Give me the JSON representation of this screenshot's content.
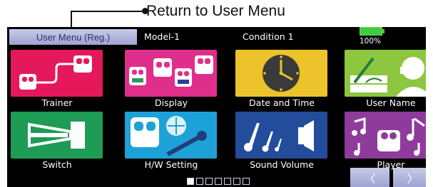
{
  "callout": {
    "text": "Return to User Menu"
  },
  "header": {
    "menu_button": "User Menu (Reg.)",
    "model": "Model-1",
    "condition": "Condition 1",
    "battery_percent": "100%"
  },
  "tiles": [
    {
      "label": "Trainer",
      "color": "#e4185a"
    },
    {
      "label": "Display",
      "color": "#e02e8c"
    },
    {
      "label": "Date and Time",
      "color": "#ecc32b"
    },
    {
      "label": "User Name",
      "color": "#8dc63f"
    },
    {
      "label": "Switch",
      "color": "#1e9b55"
    },
    {
      "label": "H/W Setting",
      "color": "#1da2d8"
    },
    {
      "label": "Sound Volume",
      "color": "#234c9a"
    },
    {
      "label": "Player",
      "color": "#8f3b9c"
    }
  ],
  "pager": {
    "current_page": 1,
    "total_pages": 7
  },
  "nav": {
    "prev": "〈",
    "next": "〉"
  }
}
